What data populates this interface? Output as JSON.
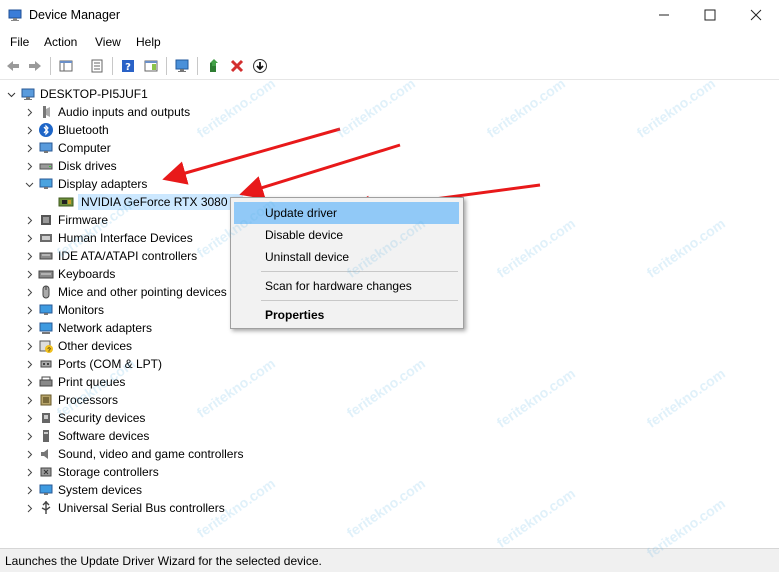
{
  "window": {
    "title": "Device Manager"
  },
  "menu": [
    "File",
    "Action",
    "View",
    "Help"
  ],
  "tree": {
    "root": "DESKTOP-PI5JUF1",
    "categories": [
      {
        "label": "Audio inputs and outputs",
        "icon": "audio-icon"
      },
      {
        "label": "Bluetooth",
        "icon": "bluetooth-icon"
      },
      {
        "label": "Computer",
        "icon": "computer-icon"
      },
      {
        "label": "Disk drives",
        "icon": "disk-icon"
      },
      {
        "label": "Display adapters",
        "icon": "display-adapter-icon",
        "expanded": true
      },
      {
        "label": "NVIDIA GeForce RTX 3080 Ti",
        "icon": "gpu-icon",
        "child": true,
        "selected": true
      },
      {
        "label": "Firmware",
        "icon": "firmware-icon"
      },
      {
        "label": "Human Interface Devices",
        "icon": "hid-icon"
      },
      {
        "label": "IDE ATA/ATAPI controllers",
        "icon": "ide-icon"
      },
      {
        "label": "Keyboards",
        "icon": "keyboard-icon"
      },
      {
        "label": "Mice and other pointing devices",
        "icon": "mouse-icon"
      },
      {
        "label": "Monitors",
        "icon": "monitor-icon"
      },
      {
        "label": "Network adapters",
        "icon": "network-icon"
      },
      {
        "label": "Other devices",
        "icon": "other-devices-icon"
      },
      {
        "label": "Ports (COM & LPT)",
        "icon": "ports-icon"
      },
      {
        "label": "Print queues",
        "icon": "printer-icon"
      },
      {
        "label": "Processors",
        "icon": "processor-icon"
      },
      {
        "label": "Security devices",
        "icon": "security-icon"
      },
      {
        "label": "Software devices",
        "icon": "software-icon"
      },
      {
        "label": "Sound, video and game controllers",
        "icon": "sound-icon"
      },
      {
        "label": "Storage controllers",
        "icon": "storage-icon"
      },
      {
        "label": "System devices",
        "icon": "system-icon"
      },
      {
        "label": "Universal Serial Bus controllers",
        "icon": "usb-icon"
      }
    ]
  },
  "context_menu": {
    "update": "Update driver",
    "disable": "Disable device",
    "uninstall": "Uninstall device",
    "scan": "Scan for hardware changes",
    "properties": "Properties"
  },
  "status": "Launches the Update Driver Wizard for the selected device.",
  "watermark": "feritekno.com",
  "colors": {
    "selection": "#cce8ff",
    "menu_highlight": "#91c9f7",
    "arrow": "#e8191a",
    "watermark": "#5bb4e6"
  }
}
